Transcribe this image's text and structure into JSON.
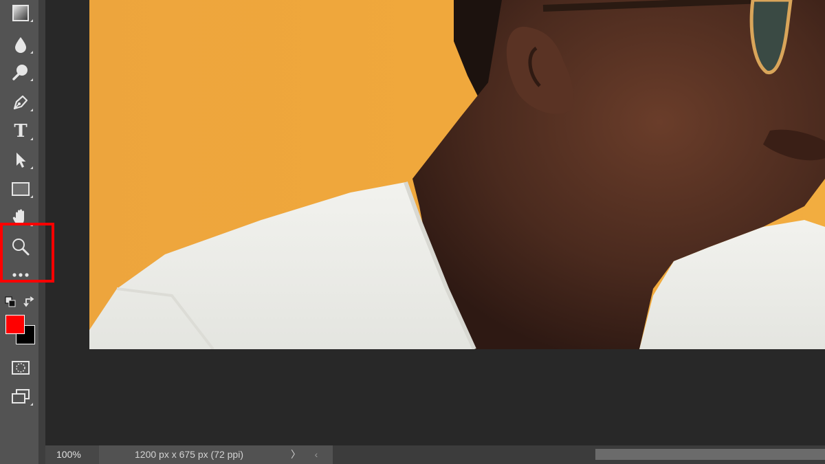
{
  "toolbar": {
    "tools": [
      {
        "name": "gradient-tool",
        "icon": "gradient-icon"
      },
      {
        "name": "blur-tool",
        "icon": "drop-icon"
      },
      {
        "name": "dodge-tool",
        "icon": "dodge-icon"
      },
      {
        "name": "pen-tool",
        "icon": "pen-icon"
      },
      {
        "name": "type-tool",
        "icon": "type-icon",
        "label": "T"
      },
      {
        "name": "path-selection-tool",
        "icon": "arrow-icon"
      },
      {
        "name": "rectangle-tool",
        "icon": "rectangle-icon"
      },
      {
        "name": "hand-tool",
        "icon": "hand-icon"
      },
      {
        "name": "zoom-tool",
        "icon": "zoom-icon"
      },
      {
        "name": "edit-toolbar",
        "icon": "more-icon"
      }
    ],
    "foreground_color": "#ff0000",
    "background_color": "#000000",
    "highlight_color": "#ff0000"
  },
  "status": {
    "zoom": "100%",
    "doc_info": "1200 px x 675 px (72 ppi)",
    "expand_glyph": "〉",
    "scroll_left_glyph": "‹"
  }
}
